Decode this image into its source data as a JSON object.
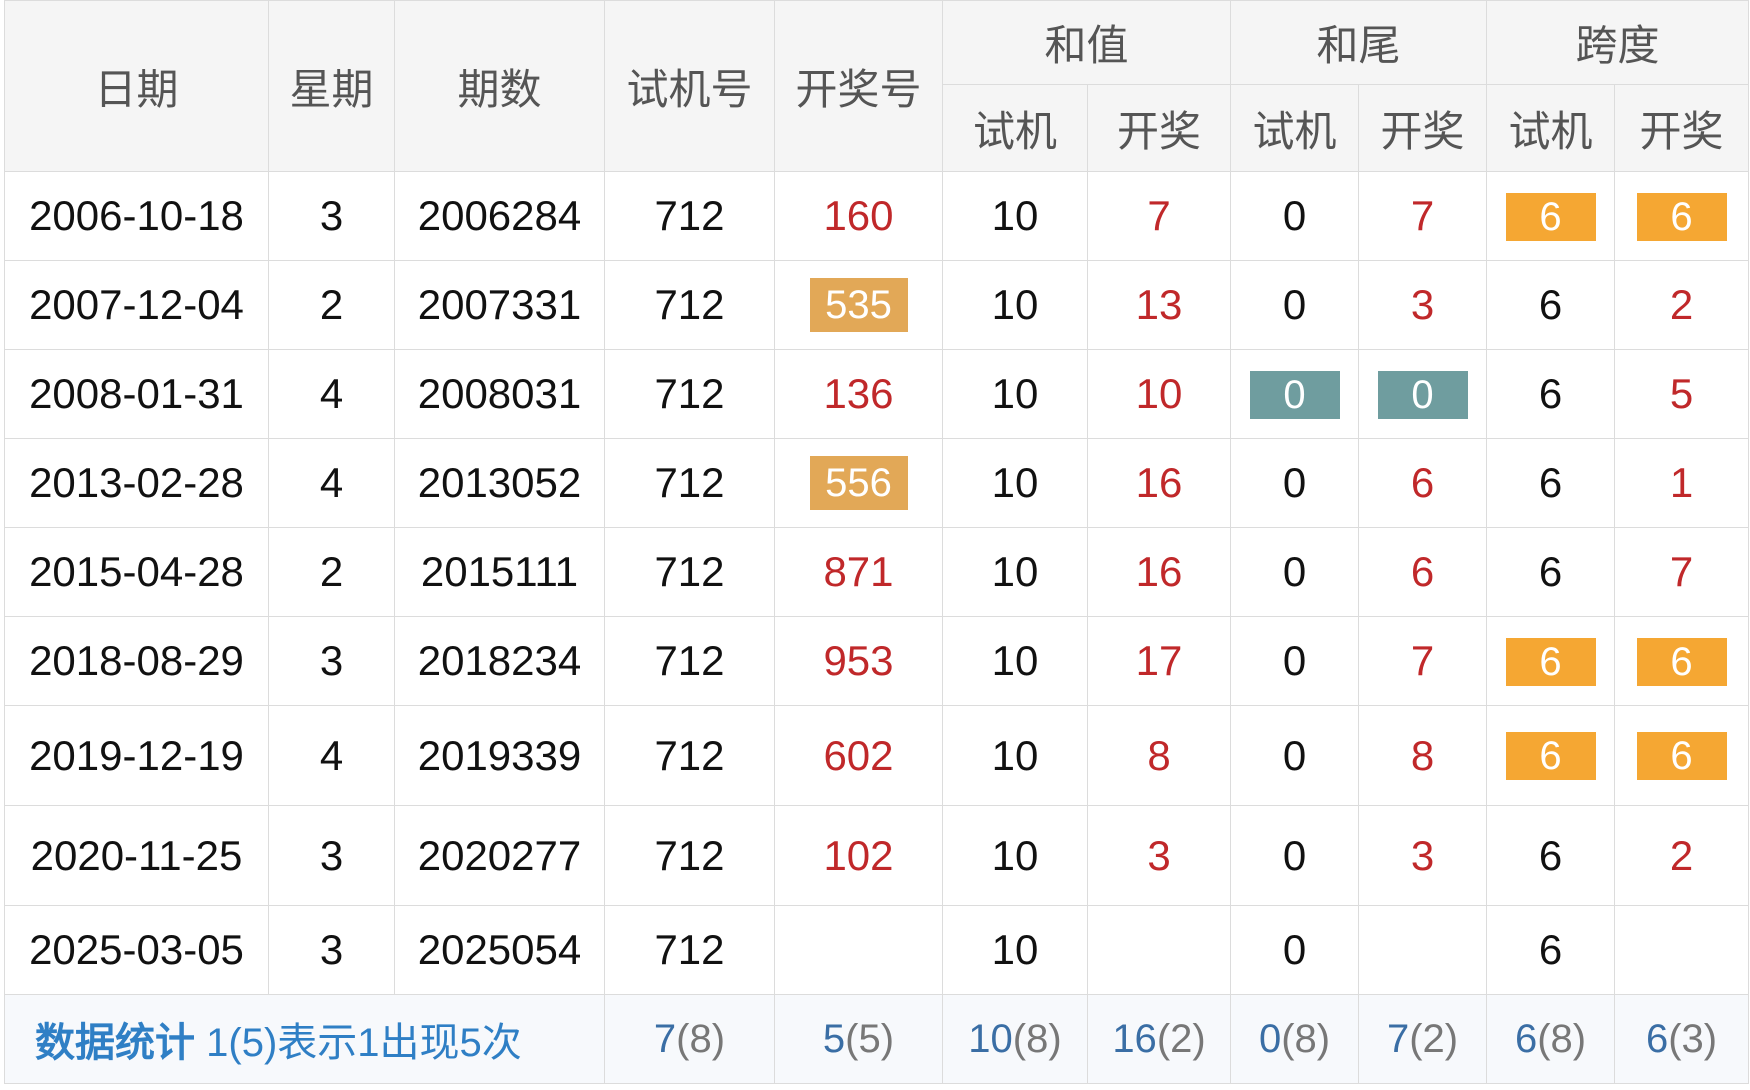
{
  "headers": {
    "date": "日期",
    "weekday": "星期",
    "issue": "期数",
    "trial": "试机号",
    "draw": "开奖号",
    "sum_group": "和值",
    "tail_group": "和尾",
    "span_group": "跨度",
    "sub_trial": "试机",
    "sub_draw": "开奖"
  },
  "rows": [
    {
      "date": "2006-10-18",
      "weekday": "3",
      "issue": "2006284",
      "trial": "712",
      "draw": "160",
      "sum_trial": "10",
      "sum_draw": "7",
      "tail_trial": "0",
      "tail_draw": "7",
      "span_trial": "6",
      "span_draw": "6"
    },
    {
      "date": "2007-12-04",
      "weekday": "2",
      "issue": "2007331",
      "trial": "712",
      "draw": "535",
      "sum_trial": "10",
      "sum_draw": "13",
      "tail_trial": "0",
      "tail_draw": "3",
      "span_trial": "6",
      "span_draw": "2"
    },
    {
      "date": "2008-01-31",
      "weekday": "4",
      "issue": "2008031",
      "trial": "712",
      "draw": "136",
      "sum_trial": "10",
      "sum_draw": "10",
      "tail_trial": "0",
      "tail_draw": "0",
      "span_trial": "6",
      "span_draw": "5"
    },
    {
      "date": "2013-02-28",
      "weekday": "4",
      "issue": "2013052",
      "trial": "712",
      "draw": "556",
      "sum_trial": "10",
      "sum_draw": "16",
      "tail_trial": "0",
      "tail_draw": "6",
      "span_trial": "6",
      "span_draw": "1"
    },
    {
      "date": "2015-04-28",
      "weekday": "2",
      "issue": "2015111",
      "trial": "712",
      "draw": "871",
      "sum_trial": "10",
      "sum_draw": "16",
      "tail_trial": "0",
      "tail_draw": "6",
      "span_trial": "6",
      "span_draw": "7"
    },
    {
      "date": "2018-08-29",
      "weekday": "3",
      "issue": "2018234",
      "trial": "712",
      "draw": "953",
      "sum_trial": "10",
      "sum_draw": "17",
      "tail_trial": "0",
      "tail_draw": "7",
      "span_trial": "6",
      "span_draw": "6"
    },
    {
      "date": "2019-12-19",
      "weekday": "4",
      "issue": "2019339",
      "trial": "712",
      "draw": "602",
      "sum_trial": "10",
      "sum_draw": "8",
      "tail_trial": "0",
      "tail_draw": "8",
      "span_trial": "6",
      "span_draw": "6"
    },
    {
      "date": "2020-11-25",
      "weekday": "3",
      "issue": "2020277",
      "trial": "712",
      "draw": "102",
      "sum_trial": "10",
      "sum_draw": "3",
      "tail_trial": "0",
      "tail_draw": "3",
      "span_trial": "6",
      "span_draw": "2"
    },
    {
      "date": "2025-03-05",
      "weekday": "3",
      "issue": "2025054",
      "trial": "712",
      "draw": "",
      "sum_trial": "10",
      "sum_draw": "",
      "tail_trial": "0",
      "tail_draw": "",
      "span_trial": "6",
      "span_draw": ""
    }
  ],
  "stats": {
    "label": "数据统计",
    "note": "1(5)表示1出现5次",
    "trial": {
      "v": "7",
      "n": "(8)"
    },
    "draw": {
      "v": "5",
      "n": "(5)"
    },
    "sum_trial": {
      "v": "10",
      "n": "(8)"
    },
    "sum_draw": {
      "v": "16",
      "n": "(2)"
    },
    "tail_trial": {
      "v": "0",
      "n": "(8)"
    },
    "tail_draw": {
      "v": "7",
      "n": "(2)"
    },
    "span_trial": {
      "v": "6",
      "n": "(8)"
    },
    "span_draw": {
      "v": "6",
      "n": "(3)"
    }
  },
  "colors": {
    "draw_text": "#c0282a",
    "badge_gold": "#e2a857",
    "badge_orange": "#f5a733",
    "badge_teal": "#6f9d9f",
    "stat_link": "#2f7fc5"
  }
}
